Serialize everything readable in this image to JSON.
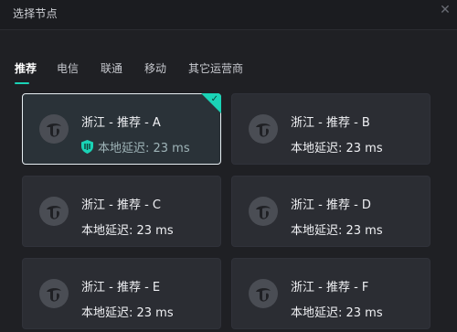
{
  "window": {
    "title": "选择节点"
  },
  "tabs": [
    {
      "label": "推荐",
      "active": true
    },
    {
      "label": "电信",
      "active": false
    },
    {
      "label": "联通",
      "active": false
    },
    {
      "label": "移动",
      "active": false
    },
    {
      "label": "其它运营商",
      "active": false
    }
  ],
  "nodes": [
    {
      "name": "浙江 - 推荐 - A",
      "latency": "本地延迟: 23 ms",
      "selected": true
    },
    {
      "name": "浙江 - 推荐 - B",
      "latency": "本地延迟: 23 ms",
      "selected": false
    },
    {
      "name": "浙江 - 推荐 - C",
      "latency": "本地延迟: 23 ms",
      "selected": false
    },
    {
      "name": "浙江 - 推荐 - D",
      "latency": "本地延迟: 23 ms",
      "selected": false
    },
    {
      "name": "浙江 - 推荐 - E",
      "latency": "本地延迟: 23 ms",
      "selected": false
    },
    {
      "name": "浙江 - 推荐 - F",
      "latency": "本地延迟: 23 ms",
      "selected": false
    }
  ],
  "colors": {
    "accent": "#1ad3b6",
    "background": "#1f2024",
    "card": "#2b2d33",
    "selected_border": "#e7eef2"
  },
  "icons": {
    "carrier": "china-telecom-logo-icon",
    "recommended": "shield-icon",
    "selected": "check-icon",
    "close": "close-icon"
  }
}
